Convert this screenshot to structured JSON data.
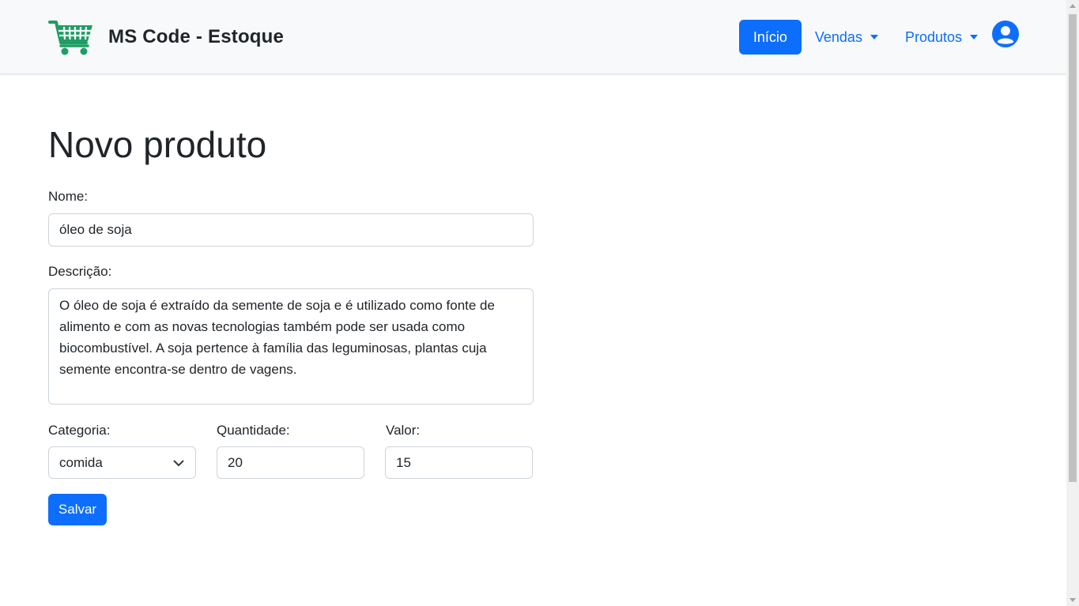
{
  "app": {
    "brand": "MS Code - Estoque",
    "brand_icon": "shopping-cart-icon",
    "colors": {
      "primary": "#0d6efd",
      "cart_green": "#1e9e64",
      "navbar_bg": "#f8f9fa"
    }
  },
  "nav": {
    "home": "Início",
    "sales": "Vendas",
    "products": "Produtos",
    "user_icon": "user-circle-icon"
  },
  "page": {
    "title": "Novo produto"
  },
  "form": {
    "name_label": "Nome:",
    "name_value": "óleo de soja",
    "description_label": "Descrição:",
    "description_value": "O óleo de soja é extraído da semente de soja e é utilizado como fonte de alimento e com as novas tecnologias também pode ser usada como biocombustível. A soja pertence à família das leguminosas, plantas cuja semente encontra-se dentro de vagens.",
    "category_label": "Categoria:",
    "category_value": "comida",
    "quantity_label": "Quantidade:",
    "quantity_value": "20",
    "value_label": "Valor:",
    "value_value": "15",
    "save_label": "Salvar"
  }
}
